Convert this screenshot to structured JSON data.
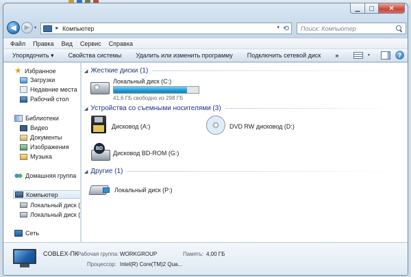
{
  "window": {
    "title_buttons": {
      "minimize": "▁",
      "maximize": "▢",
      "close": "✕"
    }
  },
  "nav": {
    "back_glyph": "◀",
    "forward_glyph": "▶",
    "address_separator": "►",
    "address_text": "Компьютер",
    "address_dropdown": "▾",
    "refresh_glyph": "⟲",
    "search_placeholder": "Поиск: Компьютер"
  },
  "menu": {
    "items": [
      "Файл",
      "Правка",
      "Вид",
      "Сервис",
      "Справка"
    ]
  },
  "toolbar": {
    "items": [
      "Упорядочить ▾",
      "Свойства системы",
      "Удалить или изменить программу",
      "Подключить сетевой диск"
    ],
    "more": "»",
    "help": "?"
  },
  "navpane": {
    "favorites": "Избранное",
    "downloads": "Загрузки",
    "recent": "Недавние места",
    "desktop": "Рабочий стол",
    "libraries": "Библиотеки",
    "video": "Видео",
    "documents": "Документы",
    "images": "Изображения",
    "music": "Музыка",
    "homegroup": "Домашняя группа",
    "computer": "Компьютер",
    "drive_c": "Локальный диск (С",
    "drive_p": "Локальный диск (Р",
    "network": "Сеть",
    "star": "★"
  },
  "content": {
    "groups": {
      "hdd": "Жесткие диски (1)",
      "removable": "Устройства со съемными носителями (3)",
      "other": "Другие (1)"
    },
    "group_arrow": "◢",
    "drive_c": {
      "label": "Локальный диск (C:)",
      "free_text": "41,6 ГБ свободно из 298 ГБ",
      "used_fraction": 0.86
    },
    "floppy": "Дисковод (A:)",
    "dvd": "DVD RW дисковод (D:)",
    "bdrom": "Дисковод BD-ROM (G:)",
    "drive_p": "Локальный диск (P:)"
  },
  "details": {
    "pc_name": "COBLEX-ПК",
    "workgroup_label": "Рабочая группа:",
    "workgroup_value": "WORKGROUP",
    "memory_label": "Память:",
    "memory_value": "4,00 ГБ",
    "cpu_label": "Процессор:",
    "cpu_value": "Intel(R) Core(TM)2 Qua..."
  },
  "colors": {
    "group_title": "#1e3287",
    "usage_fill": "#1d9bd7",
    "close_button": "#c6483a"
  }
}
